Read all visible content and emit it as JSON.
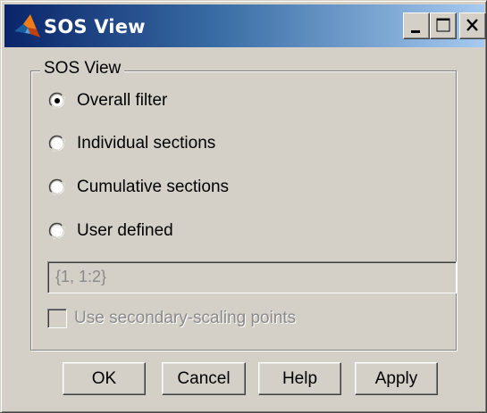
{
  "window": {
    "title": "SOS View",
    "icon": "matlab-logo-icon",
    "title_bar_colors": [
      "#0a246a",
      "#a6caf0"
    ]
  },
  "group": {
    "label": "SOS View"
  },
  "options": [
    {
      "label": "Overall filter",
      "selected": true
    },
    {
      "label": "Individual sections",
      "selected": false
    },
    {
      "label": "Cumulative sections",
      "selected": false
    },
    {
      "label": "User defined",
      "selected": false
    }
  ],
  "user_defined": {
    "value": "{1, 1:2}",
    "enabled": false
  },
  "secondary_scaling": {
    "label": "Use secondary-scaling points",
    "checked": false,
    "enabled": false
  },
  "buttons": {
    "ok": "OK",
    "cancel": "Cancel",
    "help": "Help",
    "apply": "Apply"
  }
}
